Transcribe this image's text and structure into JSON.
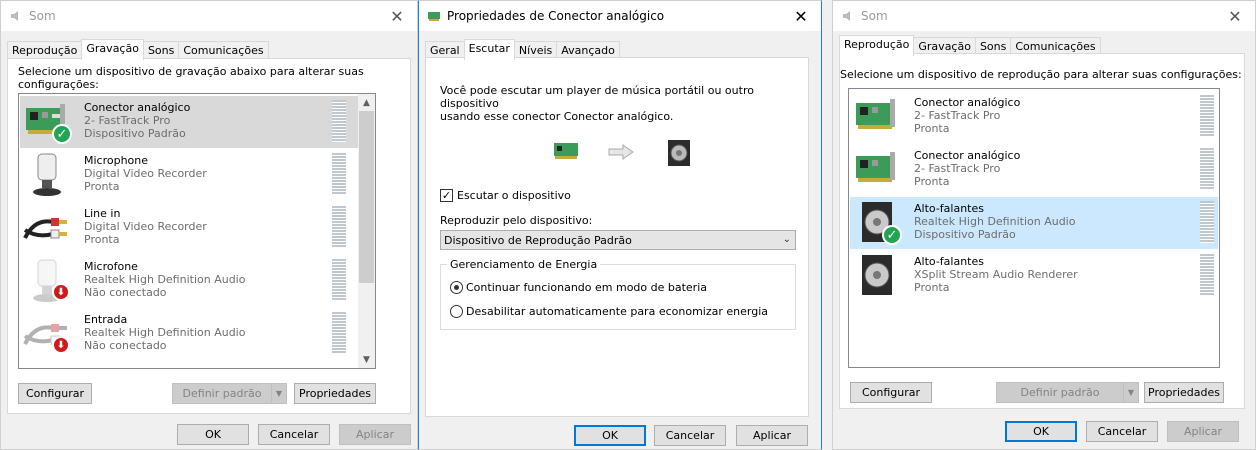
{
  "left": {
    "title": "Som",
    "tabs": [
      "Reprodução",
      "Gravação",
      "Sons",
      "Comunicações"
    ],
    "instruction_line1": "Selecione um dispositivo de gravação abaixo para alterar suas",
    "instruction_line2": "configurações:",
    "devices": [
      {
        "name": "Conector analógico",
        "sub": "2- FastTrack Pro",
        "status": "Dispositivo Padrão"
      },
      {
        "name": "Microphone",
        "sub": "Digital Video Recorder",
        "status": "Pronta"
      },
      {
        "name": "Line in",
        "sub": "Digital Video Recorder",
        "status": "Pronta"
      },
      {
        "name": "Microfone",
        "sub": "Realtek High Definition Audio",
        "status": "Não conectado"
      },
      {
        "name": "Entrada",
        "sub": "Realtek High Definition Audio",
        "status": "Não conectado"
      }
    ],
    "configure": "Configurar",
    "set_default": "Definir padrão",
    "properties": "Propriedades",
    "ok": "OK",
    "cancel": "Cancelar",
    "apply": "Aplicar"
  },
  "middle": {
    "title": "Propriedades de Conector analógico",
    "tabs": [
      "Geral",
      "Escutar",
      "Níveis",
      "Avançado"
    ],
    "desc_line1": "Você pode escutar um player de música portátil ou outro dispositivo",
    "desc_line2": "usando esse conector Conector analógico.",
    "listen_checkbox": "Escutar o dispositivo",
    "listen_checked": true,
    "playback_label": "Reproduzir pelo dispositivo:",
    "playback_value": "Dispositivo de Reprodução Padrão",
    "power_group": "Gerenciamento de Energia",
    "radio_continue": "Continuar funcionando em modo de bateria",
    "radio_disable": "Desabilitar automaticamente para economizar energia",
    "ok": "OK",
    "cancel": "Cancelar",
    "apply": "Aplicar"
  },
  "right": {
    "title": "Som",
    "tabs": [
      "Reprodução",
      "Gravação",
      "Sons",
      "Comunicações"
    ],
    "instruction": "Selecione um dispositivo de reprodução para alterar suas configurações:",
    "devices": [
      {
        "name": "Conector analógico",
        "sub": "2- FastTrack Pro",
        "status": "Pronta"
      },
      {
        "name": "Conector analógico",
        "sub": "2- FastTrack Pro",
        "status": "Pronta"
      },
      {
        "name": "Alto-falantes",
        "sub": "Realtek High Definition Audio",
        "status": "Dispositivo Padrão"
      },
      {
        "name": "Alto-falantes",
        "sub": "XSplit  Stream  Audio  Renderer",
        "status": "Pronta"
      }
    ],
    "configure": "Configurar",
    "set_default": "Definir padrão",
    "properties": "Propriedades",
    "ok": "OK",
    "cancel": "Cancelar",
    "apply": "Aplicar"
  }
}
